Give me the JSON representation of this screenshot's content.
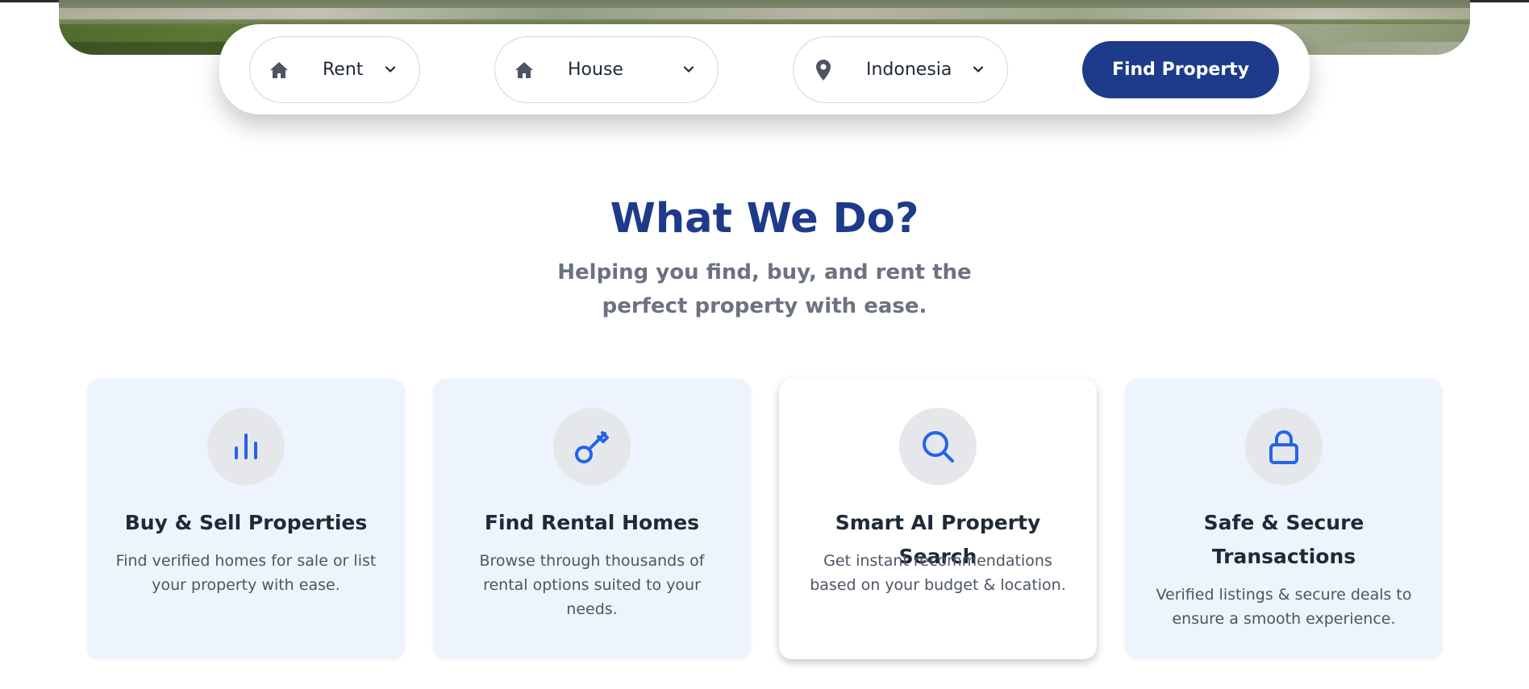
{
  "search": {
    "purpose": {
      "label": "Rent",
      "icon": "home-icon"
    },
    "type": {
      "label": "House",
      "icon": "home-icon"
    },
    "location": {
      "label": "Indonesia",
      "icon": "map-pin-icon"
    },
    "submit_label": "Find Property"
  },
  "section": {
    "title": "What We Do?",
    "subtitle": "Helping you find, buy, and rent the perfect property with ease."
  },
  "services": [
    {
      "icon": "bar-chart-icon",
      "title": "Buy & Sell Properties",
      "description": "Find verified homes for sale or list your property with ease."
    },
    {
      "icon": "key-icon",
      "title": "Find Rental Homes",
      "description": "Browse through thousands of rental options suited to your needs."
    },
    {
      "icon": "search-icon",
      "title": "Smart AI Property Search",
      "description": "Get instant recommendations based on your budget & location."
    },
    {
      "icon": "lock-icon",
      "title": "Safe & Secure Transactions",
      "description": "Verified listings & secure deals to ensure a smooth experience."
    }
  ],
  "colors": {
    "brand": "#1e3a8a",
    "icon_accent": "#2563eb",
    "card_bg": "#eef4fd",
    "muted_text": "#6b7280"
  }
}
